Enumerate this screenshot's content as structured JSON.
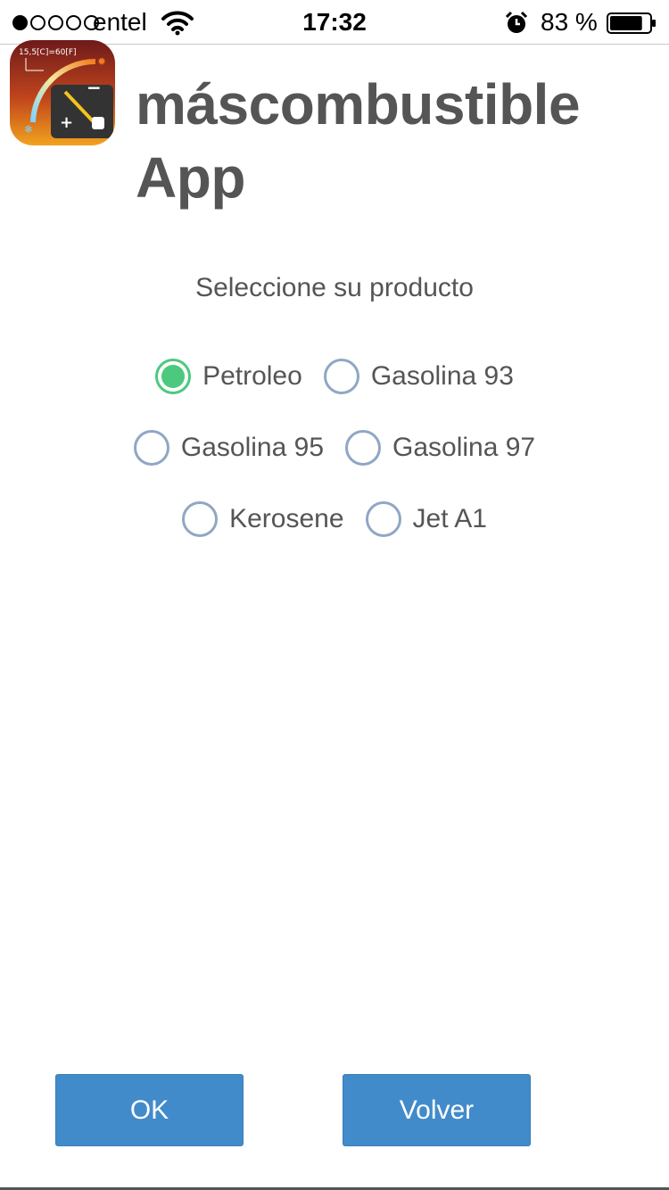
{
  "status_bar": {
    "carrier": "entel",
    "time": "17:32",
    "battery_percent": "83 %",
    "signal_bars_filled": 1,
    "signal_bars_total": 5,
    "battery_level": 0.83,
    "icons": [
      "signal-dots-icon",
      "wifi-icon",
      "alarm-clock-icon",
      "battery-icon"
    ]
  },
  "header": {
    "app_icon": "fuel-gauge-app-icon",
    "app_icon_text": "15,5[C]=60[F]",
    "title": "máscombustible App"
  },
  "form": {
    "prompt": "Seleccione su producto",
    "selected": "Petroleo",
    "options": [
      [
        "Petroleo",
        "Gasolina 93"
      ],
      [
        "Gasolina 95",
        "Gasolina 97"
      ],
      [
        "Kerosene",
        "Jet A1"
      ]
    ]
  },
  "buttons": {
    "ok_label": "OK",
    "back_label": "Volver"
  },
  "colors": {
    "selected_radio": "#4cc97e",
    "radio_border": "#8fa7c4",
    "button_bg": "#428bca",
    "title_text": "#555555"
  }
}
